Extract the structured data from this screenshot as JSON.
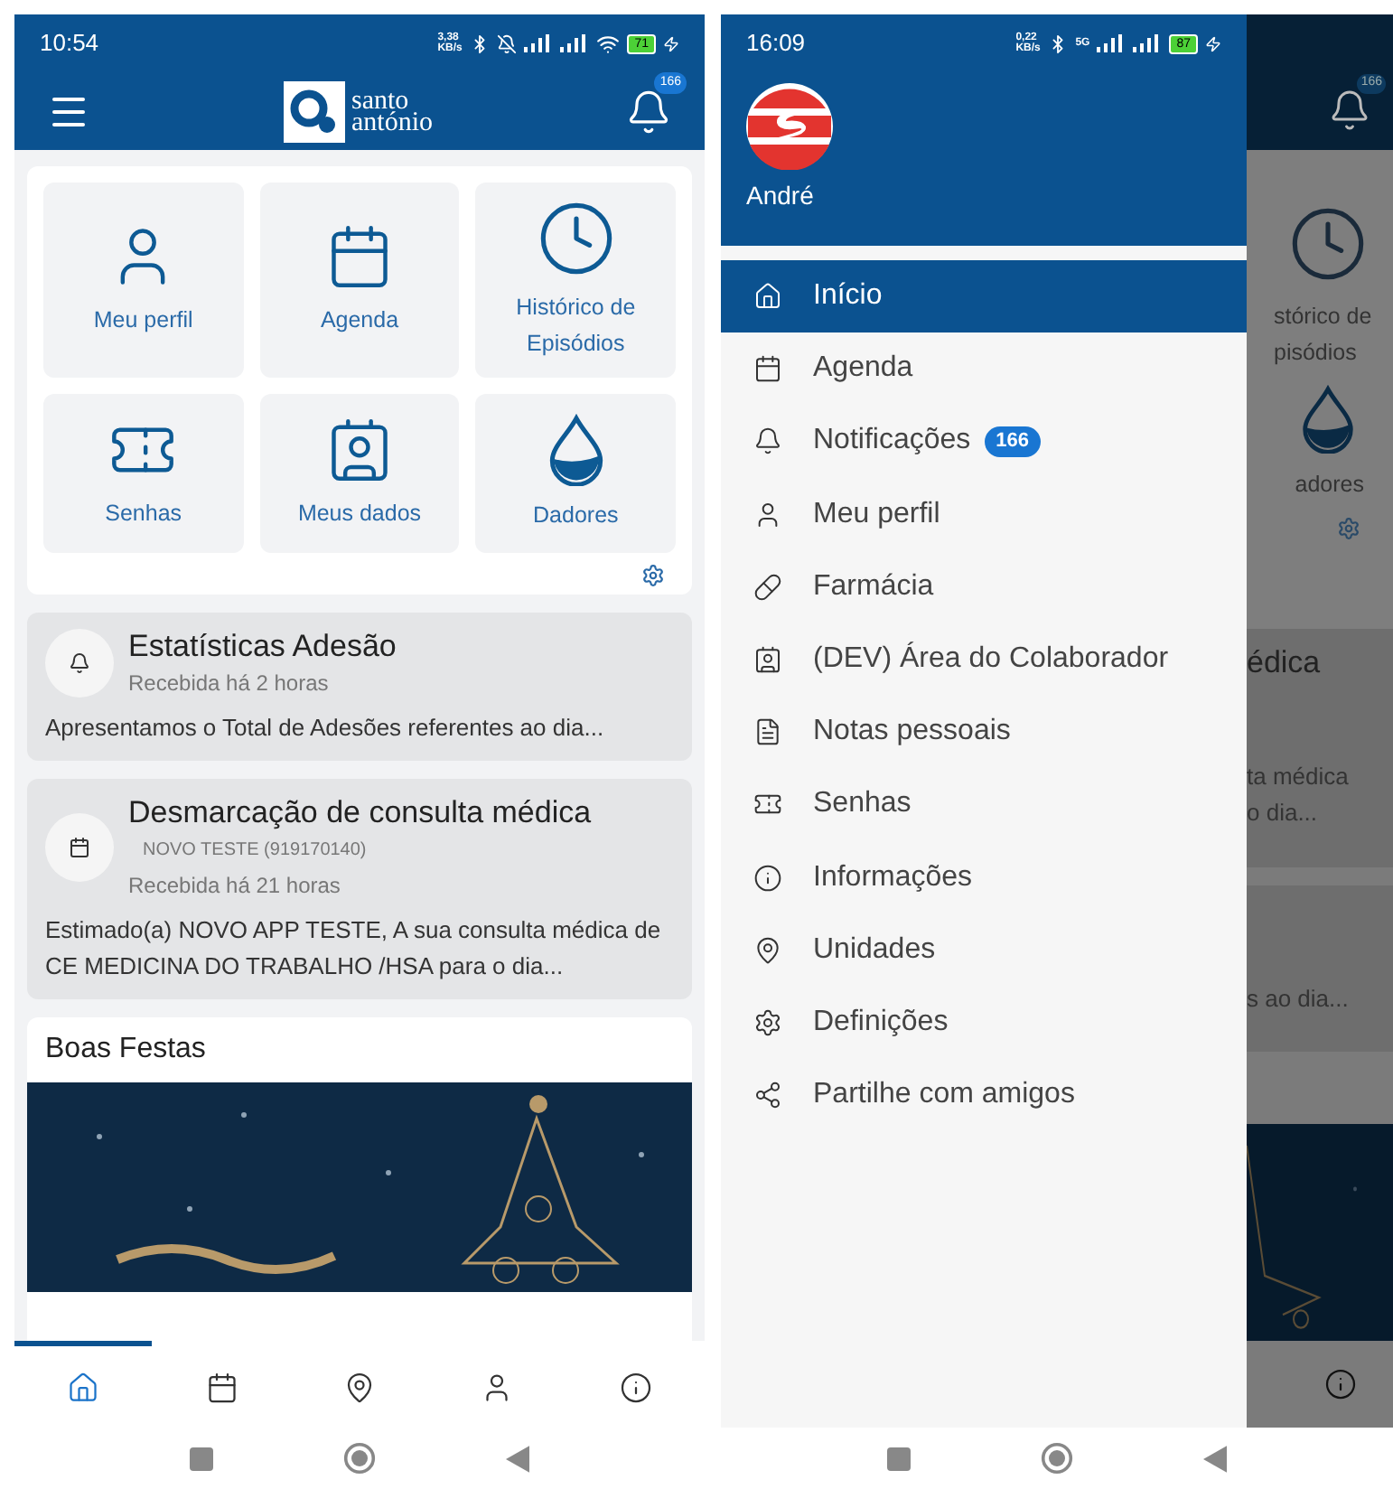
{
  "left_screen": {
    "status_bar": {
      "time": "10:54",
      "speed": "3,38 KB/s",
      "battery": "71"
    },
    "app_bar": {
      "brand_top": "santo",
      "brand_bottom": "antónio",
      "badge": "166"
    },
    "tiles": [
      {
        "label": "Meu perfil"
      },
      {
        "label": "Agenda"
      },
      {
        "label": "Histórico de Episódios"
      },
      {
        "label": "Senhas"
      },
      {
        "label": "Meus dados"
      },
      {
        "label": "Dadores"
      }
    ],
    "notifications": [
      {
        "title": "Estatísticas Adesão",
        "time": "Recebida há 2 horas",
        "body": "Apresentamos o Total de Adesões referentes ao dia..."
      },
      {
        "title": "Desmarcação de consulta médica",
        "sender": "NOVO TESTE (919170140)",
        "time": "Recebida há 21 horas",
        "body": "Estimado(a) NOVO APP TESTE, A sua consulta médica de CE MEDICINA DO TRABALHO /HSA para o dia..."
      }
    ],
    "section": {
      "title": "Boas Festas",
      "kind": "picture"
    },
    "bottom_nav": [
      {
        "selected": true
      },
      {
        "selected": false
      },
      {
        "selected": false
      },
      {
        "selected": false
      },
      {
        "selected": false
      }
    ]
  },
  "right_screen": {
    "status_bar": {
      "time": "16:09",
      "speed": "0,22 KB/s",
      "network": "5G",
      "battery": "87"
    },
    "drawer": {
      "user": "André",
      "items": [
        {
          "label": "Início",
          "selected": true
        },
        {
          "label": "Agenda",
          "selected": false
        },
        {
          "label": "Notificações",
          "selected": false,
          "badge": "166"
        },
        {
          "label": "Meu perfil",
          "selected": false
        },
        {
          "label": "Farmácia",
          "selected": false
        },
        {
          "label": "(DEV) Área do Colaborador",
          "selected": false
        },
        {
          "label": "Notas pessoais",
          "selected": false
        },
        {
          "label": "Senhas",
          "selected": false
        },
        {
          "label": "Informações",
          "selected": false
        },
        {
          "label": "Unidades",
          "selected": false
        },
        {
          "label": "Definições",
          "selected": false
        },
        {
          "label": "Partilhe com amigos",
          "selected": false
        }
      ]
    },
    "background": {
      "badge": "166",
      "tile_label": "stórico de pisódios",
      "tile_label_2": "adores",
      "card_title": "édica",
      "card_body": "ta médica o dia...",
      "card_body_2": "s ao dia..."
    }
  }
}
